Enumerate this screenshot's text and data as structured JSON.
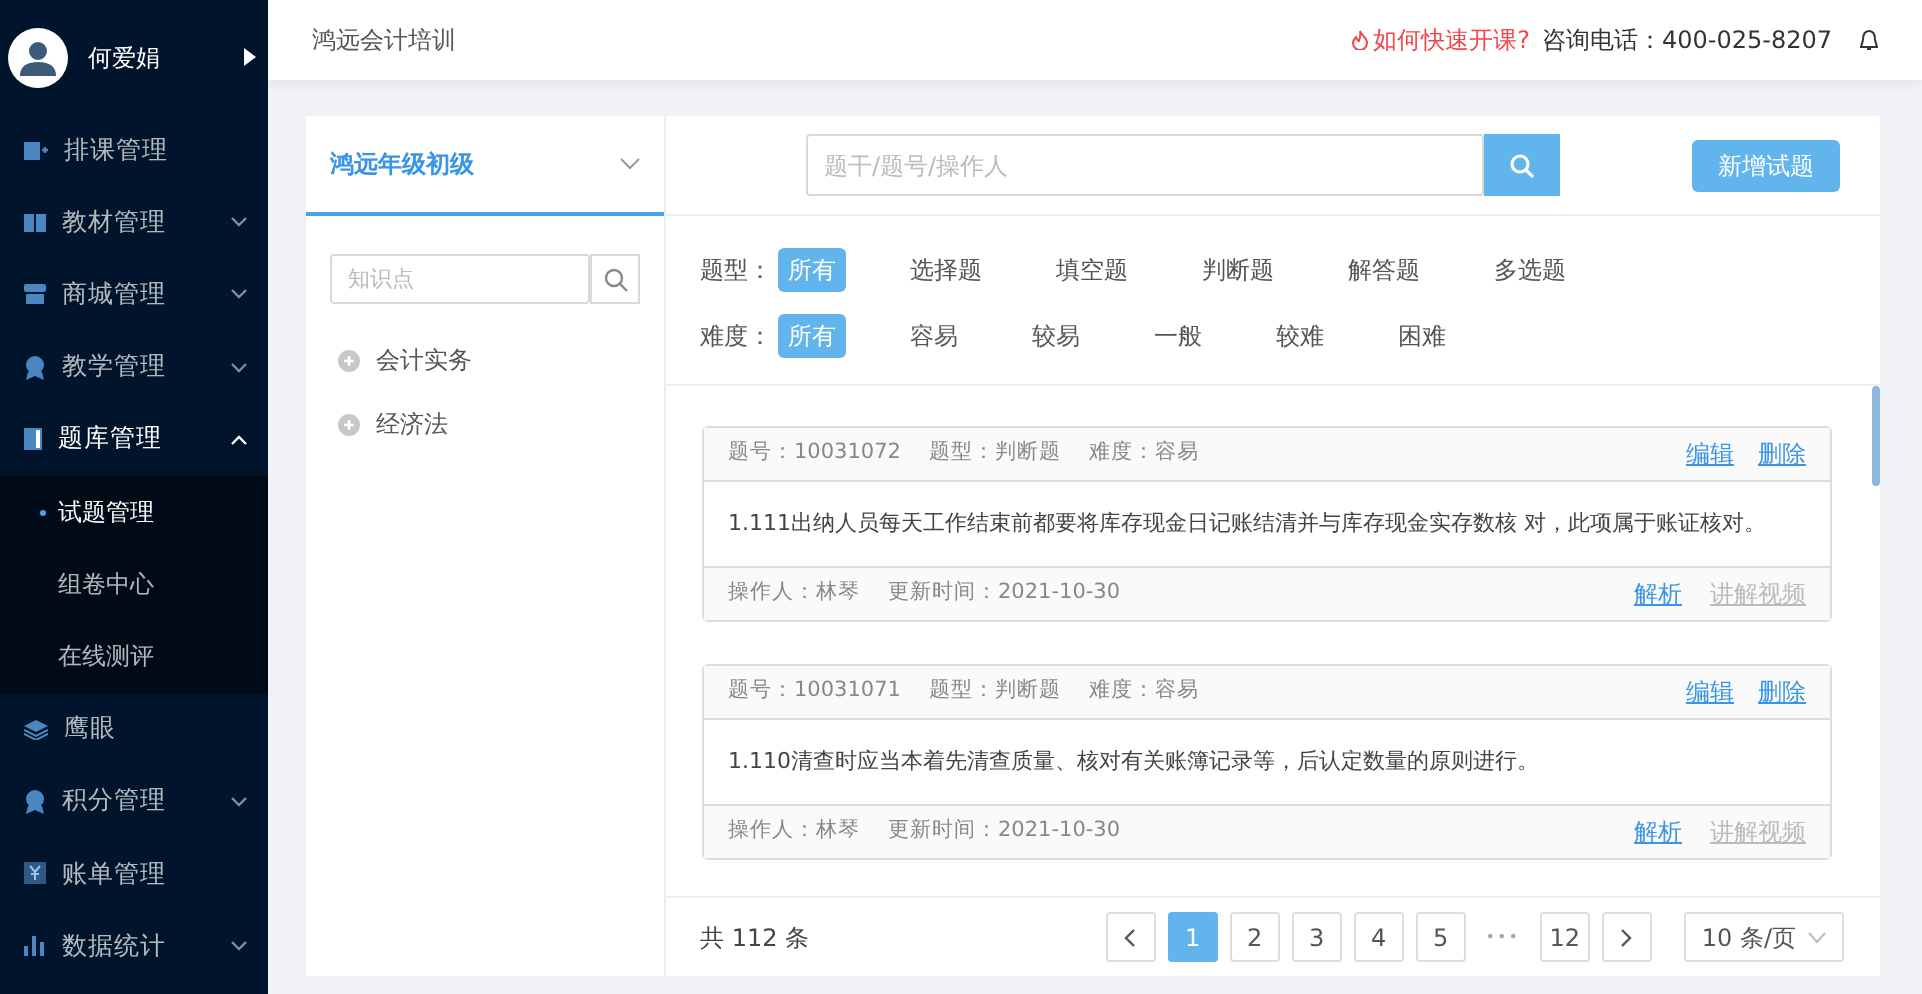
{
  "sidebar": {
    "user": {
      "name": "何爱娟"
    },
    "items": [
      {
        "label": "排课管理",
        "kind": "link",
        "selected": false
      },
      {
        "label": "教材管理",
        "kind": "menu",
        "expanded": false,
        "selected": false
      },
      {
        "label": "商城管理",
        "kind": "menu",
        "expanded": false,
        "selected": false
      },
      {
        "label": "教学管理",
        "kind": "menu",
        "expanded": false,
        "selected": false
      },
      {
        "label": "题库管理",
        "kind": "menu",
        "expanded": true,
        "selected": true,
        "children": [
          {
            "label": "试题管理",
            "selected": true
          },
          {
            "label": "组卷中心",
            "selected": false
          },
          {
            "label": "在线测评",
            "selected": false
          }
        ]
      },
      {
        "label": "鹰眼",
        "kind": "link",
        "selected": false
      },
      {
        "label": "积分管理",
        "kind": "menu",
        "expanded": false,
        "selected": false
      },
      {
        "label": "账单管理",
        "kind": "link",
        "selected": false
      },
      {
        "label": "数据统计",
        "kind": "menu",
        "expanded": false,
        "selected": false
      }
    ]
  },
  "header": {
    "title": "鸿远会计培训",
    "help_link": "如何快速开课?",
    "phone": "咨询电话：400-025-8207"
  },
  "knowledge_panel": {
    "grade_select": "鸿远年级初级",
    "search": {
      "placeholder": "知识点"
    },
    "tree": [
      {
        "label": "会计实务",
        "expanded": false
      },
      {
        "label": "经济法",
        "expanded": false
      }
    ]
  },
  "toolbar": {
    "search": {
      "placeholder": "题干/题号/操作人"
    },
    "add_button": "新增试题"
  },
  "filters": [
    {
      "label": "题型：",
      "options": [
        {
          "label": "所有",
          "selected": true
        },
        {
          "label": "选择题",
          "selected": false
        },
        {
          "label": "填空题",
          "selected": false
        },
        {
          "label": "判断题",
          "selected": false
        },
        {
          "label": "解答题",
          "selected": false
        },
        {
          "label": "多选题",
          "selected": false
        }
      ]
    },
    {
      "label": "难度：",
      "options": [
        {
          "label": "所有",
          "selected": true
        },
        {
          "label": "容易",
          "selected": false
        },
        {
          "label": "较易",
          "selected": false
        },
        {
          "label": "一般",
          "selected": false
        },
        {
          "label": "较难",
          "selected": false
        },
        {
          "label": "困难",
          "selected": false
        }
      ]
    }
  ],
  "questions": [
    {
      "number": "题号：10031072",
      "type": "题型：判断题",
      "difficulty": "难度：容易",
      "actions": [
        "编辑",
        "删除"
      ],
      "text": "1.111出纳人员每天工作结束前都要将库存现金日记账结清并与库存现金实存数核 对，此项属于账证核对。",
      "operator": "操作人：林琴",
      "updated": "更新时间：2021-10-30",
      "footer_actions": [
        {
          "label": "解析",
          "disabled": false
        },
        {
          "label": "讲解视频",
          "disabled": true
        }
      ]
    },
    {
      "number": "题号：10031071",
      "type": "题型：判断题",
      "difficulty": "难度：容易",
      "actions": [
        "编辑",
        "删除"
      ],
      "text": "1.110清查时应当本着先清查质量、核对有关账簿记录等，后认定数量的原则进行。",
      "operator": "操作人：林琴",
      "updated": "更新时间：2021-10-30",
      "footer_actions": [
        {
          "label": "解析",
          "disabled": false
        },
        {
          "label": "讲解视频",
          "disabled": true
        }
      ]
    }
  ],
  "pagination": {
    "total": "共 112 条",
    "pages": [
      {
        "kind": "page",
        "label": "1",
        "selected": true
      },
      {
        "kind": "page",
        "label": "2",
        "selected": false
      },
      {
        "kind": "page",
        "label": "3",
        "selected": false
      },
      {
        "kind": "page",
        "label": "4",
        "selected": false
      },
      {
        "kind": "page",
        "label": "5",
        "selected": false
      },
      {
        "kind": "ellipsis",
        "label": "•••"
      },
      {
        "kind": "page",
        "label": "12",
        "selected": false
      }
    ],
    "page_size": "10 条/页"
  }
}
